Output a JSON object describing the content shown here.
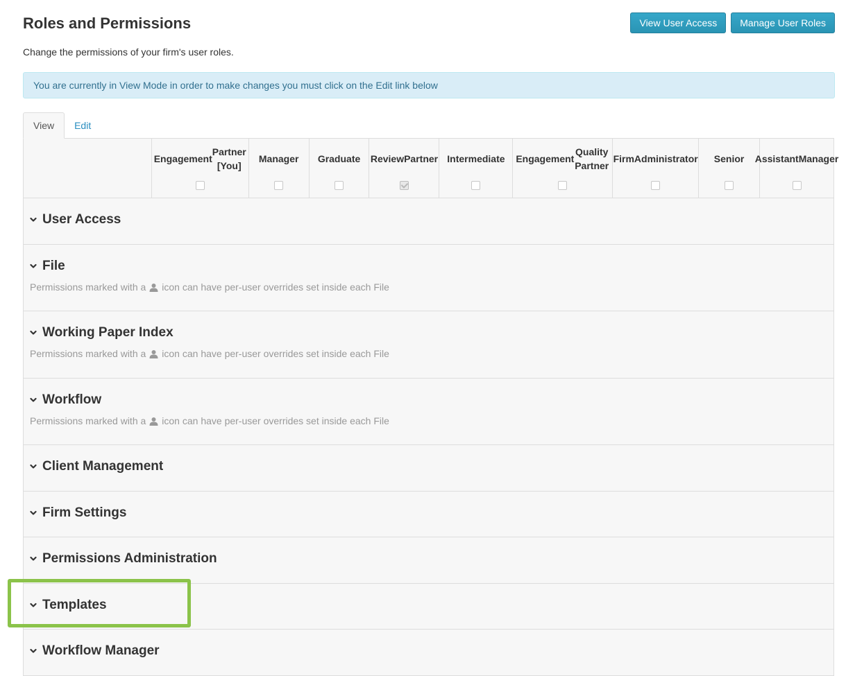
{
  "header": {
    "title": "Roles and Permissions",
    "subtitle": "Change the permissions of your firm's user roles.",
    "buttons": [
      "View User Access",
      "Manage User Roles"
    ]
  },
  "alert": {
    "text": "You are currently in View Mode in order to make changes you must click on the Edit link below"
  },
  "tabs": [
    {
      "label": "View",
      "active": true
    },
    {
      "label": "Edit",
      "active": false
    }
  ],
  "roles": [
    {
      "name_line1": "Engagement",
      "name_line2": "Partner [You]",
      "checked": false
    },
    {
      "name_line1": "Manager",
      "name_line2": "",
      "checked": false
    },
    {
      "name_line1": "Graduate",
      "name_line2": "",
      "checked": false
    },
    {
      "name_line1": "Review",
      "name_line2": "Partner",
      "checked": true
    },
    {
      "name_line1": "Intermediate",
      "name_line2": "",
      "checked": false
    },
    {
      "name_line1": "Engagement",
      "name_line2": "Quality Partner",
      "checked": false
    },
    {
      "name_line1": "Firm",
      "name_line2": "Administrator",
      "checked": false
    },
    {
      "name_line1": "Senior",
      "name_line2": "",
      "checked": false
    },
    {
      "name_line1": "Assistant",
      "name_line2": "Manager",
      "checked": false
    }
  ],
  "note": {
    "before_icon": "Permissions marked with a",
    "after_icon": "icon can have per-user overrides set inside each File",
    "icon": "person-icon"
  },
  "sections": [
    {
      "title": "User Access",
      "has_note": false
    },
    {
      "title": "File",
      "has_note": true
    },
    {
      "title": "Working Paper Index",
      "has_note": true
    },
    {
      "title": "Workflow",
      "has_note": true
    },
    {
      "title": "Client Management",
      "has_note": false
    },
    {
      "title": "Firm Settings",
      "has_note": false
    },
    {
      "title": "Permissions Administration",
      "has_note": false
    },
    {
      "title": "Templates",
      "has_note": false
    },
    {
      "title": "Workflow Manager",
      "has_note": false
    }
  ],
  "colors": {
    "button": "#2a94b4",
    "alert_bg": "#d9edf7",
    "alert_text": "#31708f",
    "highlight": "#8bc34a",
    "link": "#2a8ec0"
  }
}
